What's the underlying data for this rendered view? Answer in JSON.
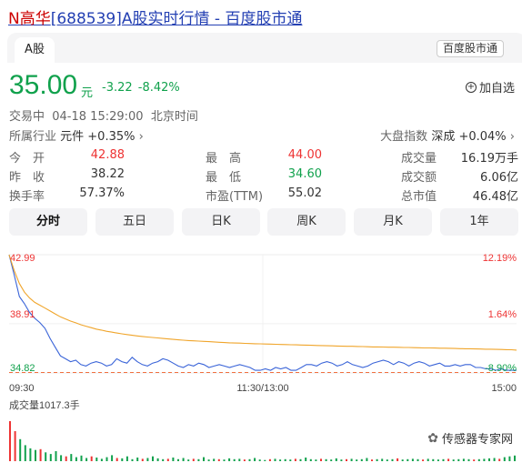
{
  "title": {
    "name": "N高华",
    "rest": "[688539]A股实时行情 - 百度股市通"
  },
  "tab": "A股",
  "source_badge": "百度股市通",
  "price": {
    "value": "35.00",
    "unit": "元",
    "change": "-3.22",
    "change_pct": "-8.42%"
  },
  "add_label": "加自选",
  "status": "交易中  04-18 15:29:00  北京时间",
  "industry": {
    "label": "所属行业",
    "value": "元件 +0.35%"
  },
  "market": {
    "label": "大盘指数",
    "value": "深成 +0.04%"
  },
  "stats": [
    [
      {
        "label": "今　开",
        "value": "42.88",
        "color": "red"
      },
      {
        "label": "最　高",
        "value": "44.00",
        "color": "red"
      },
      {
        "label": "成交量",
        "value": "16.19万手",
        "color": "dark"
      }
    ],
    [
      {
        "label": "昨　收",
        "value": "38.22",
        "color": "dark"
      },
      {
        "label": "最　低",
        "value": "34.60",
        "color": "green"
      },
      {
        "label": "成交额",
        "value": "6.06亿",
        "color": "dark"
      }
    ],
    [
      {
        "label": "换手率",
        "value": "57.37%",
        "color": "dark"
      },
      {
        "label": "市盈(TTM)",
        "value": "55.02",
        "color": "dark"
      },
      {
        "label": "总市值",
        "value": "46.48亿",
        "color": "dark"
      }
    ]
  ],
  "periods": [
    "分时",
    "五日",
    "日K",
    "周K",
    "月K",
    "1年"
  ],
  "colors": {
    "up": "#e33333",
    "down": "#10a14c",
    "price_line": "#3a64d8",
    "avg_line": "#f0a52b",
    "ref_line": "#f07040"
  },
  "chart_data": {
    "type": "line",
    "ylim": [
      34.82,
      42.99
    ],
    "y_left_labels": [
      "42.99",
      "38.91",
      "34.82"
    ],
    "y_right_labels": [
      "12.19%",
      "1.64%",
      "-8.90%"
    ],
    "x_labels": [
      "09:30",
      "11:30/13:00",
      "15:00"
    ],
    "series": [
      {
        "values": [
          42.99,
          41.6,
          40.1,
          39.6,
          39.0,
          38.6,
          38.3,
          37.9,
          37.2,
          36.6,
          36.0,
          35.8,
          35.6,
          35.7,
          35.4,
          35.3,
          35.5,
          35.6,
          35.5,
          35.3,
          35.4,
          35.8,
          35.6,
          35.5,
          35.9,
          35.6,
          35.4,
          35.3,
          35.5,
          35.6,
          35.8,
          35.7,
          35.5,
          35.3,
          35.2,
          35.4,
          35.3,
          35.5,
          35.4,
          35.2,
          35.3,
          35.4,
          35.3,
          35.2,
          35.3,
          35.4,
          35.3,
          35.2,
          35.0,
          35.0,
          35.1,
          35.0,
          35.2,
          35.1,
          35.2,
          35.0,
          35.0,
          35.2,
          35.4,
          35.4,
          35.3,
          35.5,
          35.6,
          35.5,
          35.3,
          35.4,
          35.6,
          35.4,
          35.3,
          35.2,
          35.3,
          35.5,
          35.6,
          35.7,
          35.6,
          35.4,
          35.6,
          35.5,
          35.3,
          35.5,
          35.6,
          35.5,
          35.3,
          35.4,
          35.5,
          35.3,
          35.3,
          35.4,
          35.3,
          35.4,
          35.4,
          35.2,
          35.2,
          35.1,
          35.1,
          35.0,
          35.1,
          35.0,
          35.0,
          35.0
        ]
      },
      {
        "values": [
          42.99,
          41.9,
          41.0,
          40.4,
          40.0,
          39.7,
          39.5,
          39.3,
          39.1,
          38.9,
          38.7,
          38.55,
          38.4,
          38.28,
          38.15,
          38.05,
          37.95,
          37.85,
          37.78,
          37.7,
          37.64,
          37.58,
          37.52,
          37.47,
          37.42,
          37.38,
          37.34,
          37.3,
          37.27,
          37.24,
          37.2,
          37.17,
          37.14,
          37.11,
          37.08,
          37.06,
          37.04,
          37.02,
          37.0,
          36.98,
          36.96,
          36.94,
          36.92,
          36.9,
          36.89,
          36.88,
          36.86,
          36.85,
          36.84,
          36.83,
          36.82,
          36.81,
          36.8,
          36.79,
          36.78,
          36.77,
          36.76,
          36.75,
          36.74,
          36.73,
          36.72,
          36.71,
          36.7,
          36.69,
          36.68,
          36.67,
          36.66,
          36.66,
          36.65,
          36.64,
          36.63,
          36.62,
          36.62,
          36.61,
          36.6,
          36.6,
          36.59,
          36.58,
          36.58,
          36.57,
          36.56,
          36.55,
          36.55,
          36.54,
          36.53,
          36.53,
          36.52,
          36.51,
          36.5,
          36.49,
          36.49,
          36.48,
          36.47,
          36.46,
          36.46,
          36.45,
          36.44,
          36.43,
          36.42,
          36.4
        ]
      }
    ],
    "reference": 38.22,
    "volume_label": "成交量1017.3手",
    "volume_ratio": [
      1.0,
      0.75,
      0.55,
      0.4,
      0.32,
      0.28,
      0.3,
      0.22,
      0.18,
      0.25,
      0.15,
      0.12,
      0.18,
      0.1,
      0.14,
      0.08,
      0.12,
      0.09,
      0.06,
      0.1,
      0.15,
      0.08,
      0.07,
      0.12,
      0.05,
      0.09,
      0.06,
      0.08,
      0.12,
      0.07,
      0.05,
      0.06,
      0.09,
      0.05,
      0.08,
      0.04,
      0.06,
      0.05,
      0.1,
      0.04,
      0.06,
      0.05,
      0.04,
      0.07,
      0.05,
      0.06,
      0.04,
      0.05,
      0.08,
      0.04,
      0.03,
      0.05,
      0.06,
      0.04,
      0.05,
      0.04,
      0.06,
      0.05,
      0.09,
      0.05,
      0.04,
      0.06,
      0.05,
      0.04,
      0.07,
      0.04,
      0.05,
      0.06,
      0.04,
      0.05,
      0.08,
      0.04,
      0.05,
      0.06,
      0.04,
      0.05,
      0.07,
      0.04,
      0.05,
      0.06,
      0.05,
      0.04,
      0.06,
      0.05,
      0.04,
      0.05,
      0.06,
      0.04,
      0.05,
      0.06,
      0.05,
      0.04,
      0.05,
      0.06,
      0.07,
      0.08,
      0.06,
      0.1,
      0.12,
      0.14
    ]
  },
  "watermark": "传感器专家网"
}
